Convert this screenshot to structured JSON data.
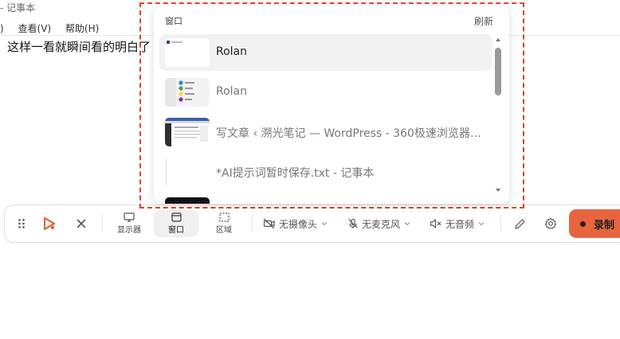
{
  "notepad": {
    "title": "- 记事本",
    "menu": [
      ")",
      "查看(V)",
      "帮助(H)"
    ],
    "content": "这样一看就瞬间看的明白了"
  },
  "toolbar": {
    "modes": [
      {
        "label": "显示器",
        "icon": "monitor-icon",
        "active": false
      },
      {
        "label": "窗口",
        "icon": "window-icon",
        "active": true
      },
      {
        "label": "区域",
        "icon": "region-icon",
        "active": false
      }
    ],
    "camera": "无摄像头",
    "mic": "无麦克风",
    "audio": "无音频",
    "record_label": "录制"
  },
  "window_picker": {
    "header": "窗口",
    "refresh": "刷新",
    "windows": [
      {
        "label": "Rolan",
        "selected": true
      },
      {
        "label": "Rolan",
        "selected": false
      },
      {
        "label": "写文章 ‹ 溯光笔记 — WordPress - 360极速浏览器X ...",
        "selected": false
      },
      {
        "label": "*AI提示词暂时保存.txt - 记事本",
        "selected": false
      }
    ]
  },
  "colors": {
    "accent": "#e8643f",
    "selection_border": "#d9472b"
  }
}
